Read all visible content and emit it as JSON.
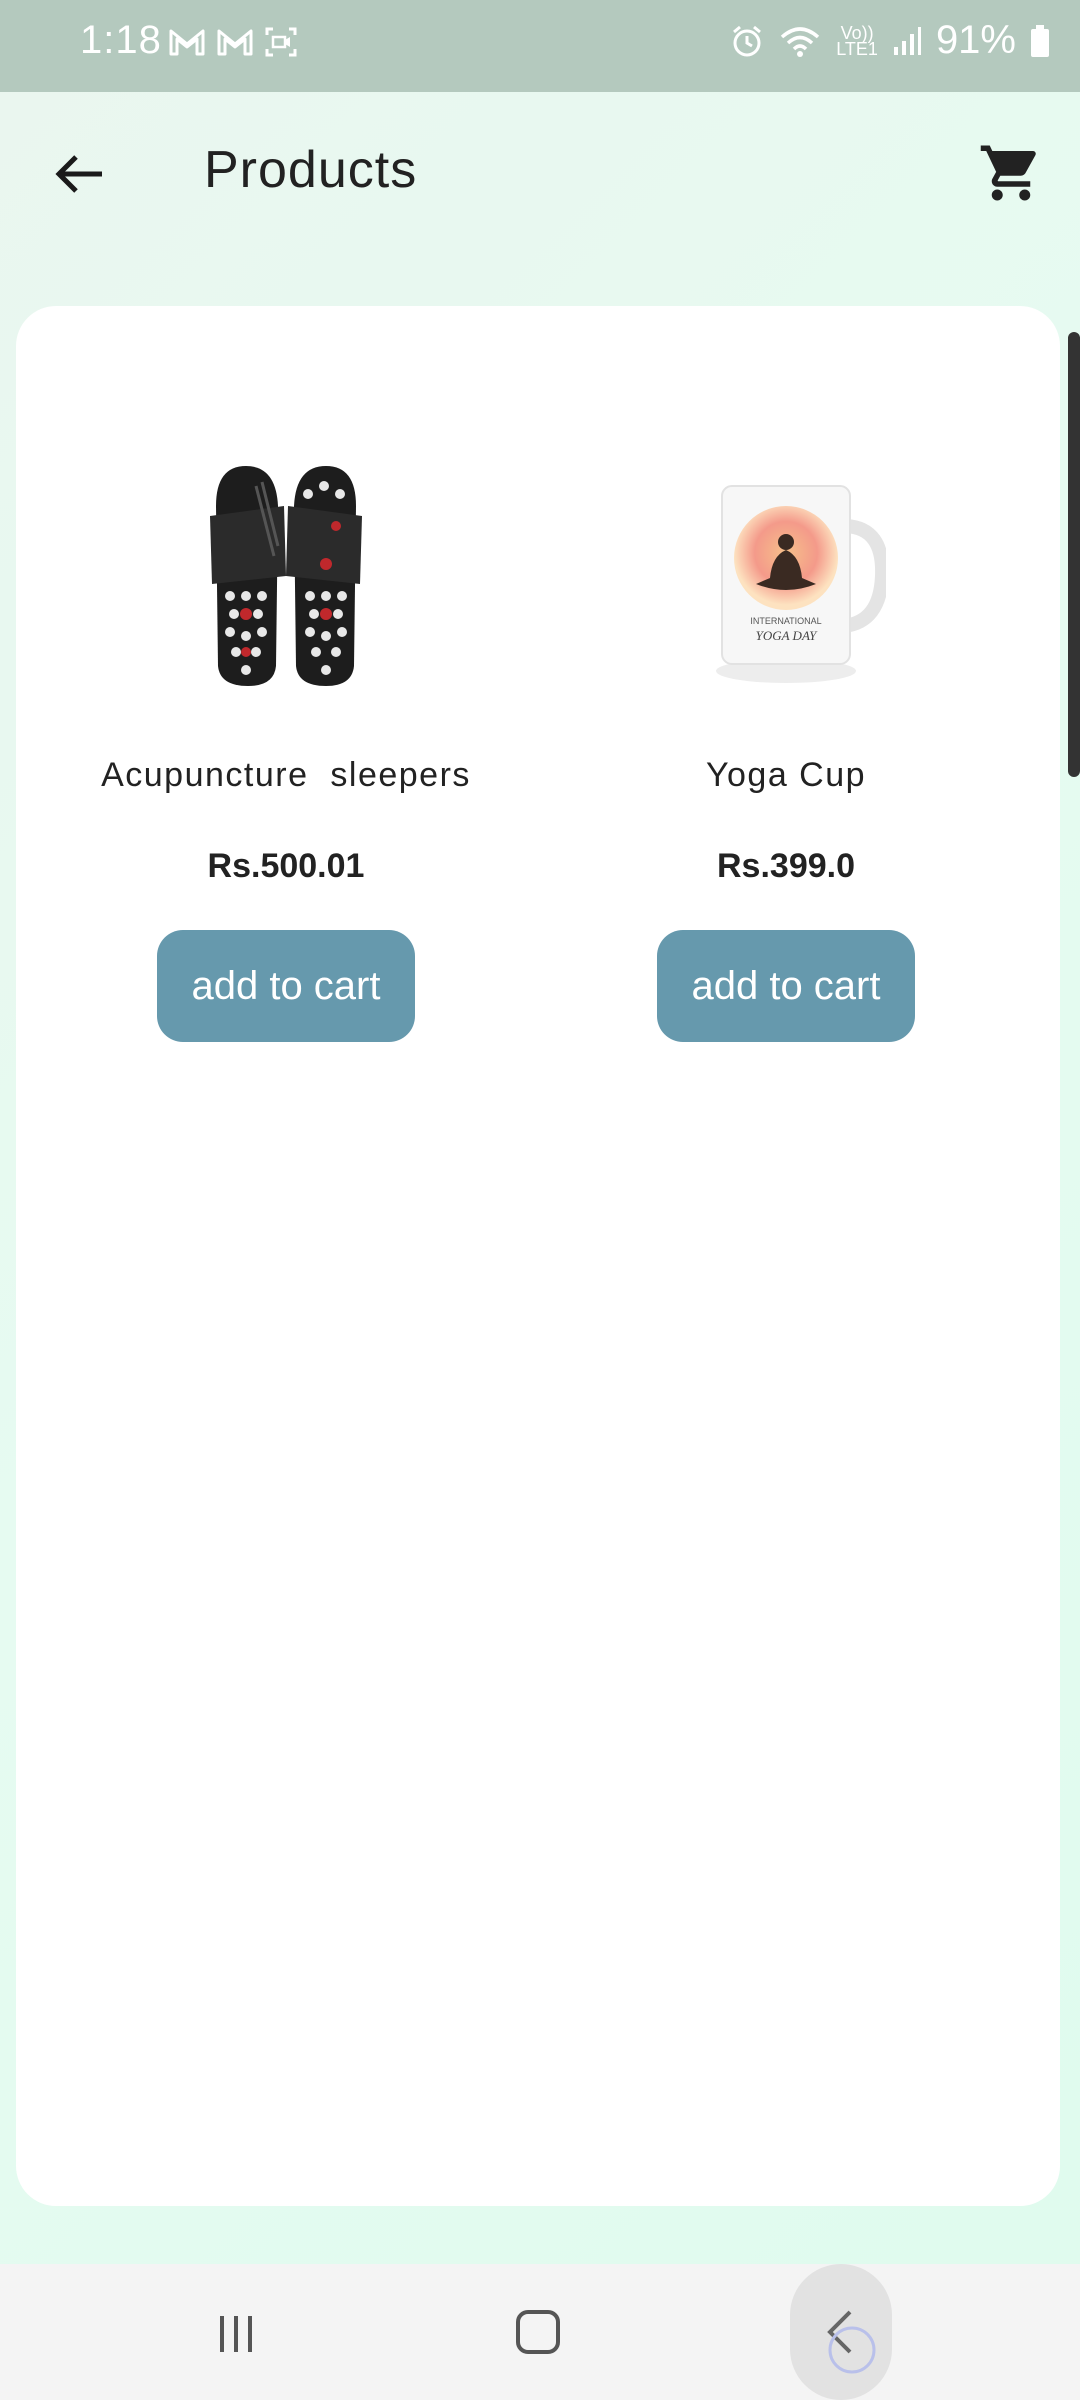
{
  "status_bar": {
    "time": "1:18",
    "volte_top": "Vo))",
    "volte_bottom": "LTE1",
    "battery": "91%"
  },
  "header": {
    "title": "Products",
    "back_icon": "arrow-left-icon",
    "cart_icon": "shopping-cart-icon"
  },
  "products": [
    {
      "name": "Acupuncture  sleepers",
      "price": "Rs.500.01",
      "button": "add to cart",
      "image": "slippers-image"
    },
    {
      "name": "Yoga Cup",
      "price": "Rs.399.0",
      "button": "add to cart",
      "image": "mug-image"
    }
  ],
  "mug_print": {
    "line1": "INTERNATIONAL",
    "line2": "YOGA DAY"
  },
  "colors": {
    "button": "#6699ad",
    "status_bar": "#b4c9be",
    "background": "#e6fbf1"
  }
}
